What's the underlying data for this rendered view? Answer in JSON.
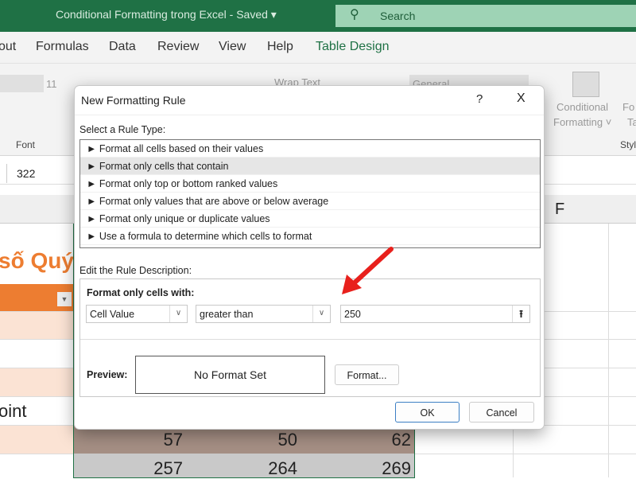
{
  "app": {
    "title": "Conditional Formatting trong Excel  -  Saved  ▾",
    "search_placeholder": "Search"
  },
  "menu": [
    "out",
    "Formulas",
    "Data",
    "Review",
    "View",
    "Help",
    "Table Design"
  ],
  "ribbon": {
    "font_size": "11",
    "wrap_text": "Wrap Text",
    "number_format": "General",
    "font_group": "Font",
    "cond_fmt_1": "Conditional",
    "cond_fmt_2": "Formatting ˅",
    "fmt_table_1": "Fo",
    "fmt_table_2": "Ta",
    "styles_group": "Styl"
  },
  "formula_bar": {
    "value": "322"
  },
  "sheet": {
    "col_f": "F",
    "title_fragment": "số Quý",
    "row_label": "oint",
    "row1": [
      "57",
      "50",
      "62"
    ],
    "row2": [
      "257",
      "264",
      "269"
    ]
  },
  "dialog": {
    "title": "New Formatting Rule",
    "help": "?",
    "close": "X",
    "rule_type_label": "Select a Rule Type:",
    "rule_types": [
      "► Format all cells based on their values",
      "► Format only cells that contain",
      "► Format only top or bottom ranked values",
      "► Format only values that are above or below average",
      "► Format only unique or duplicate values",
      "► Use a formula to determine which cells to format"
    ],
    "selected_index": 1,
    "edit_label": "Edit the Rule Description:",
    "format_only_label": "Format only cells with:",
    "field1": "Cell Value",
    "operator": "greater than",
    "value": "250",
    "preview_label": "Preview:",
    "preview_text": "No Format Set",
    "format_button": "Format...",
    "ok": "OK",
    "cancel": "Cancel"
  },
  "colors": {
    "excel_green": "#1f7145",
    "accent_orange": "#ed7d31",
    "annotation_red": "#e8201c"
  }
}
